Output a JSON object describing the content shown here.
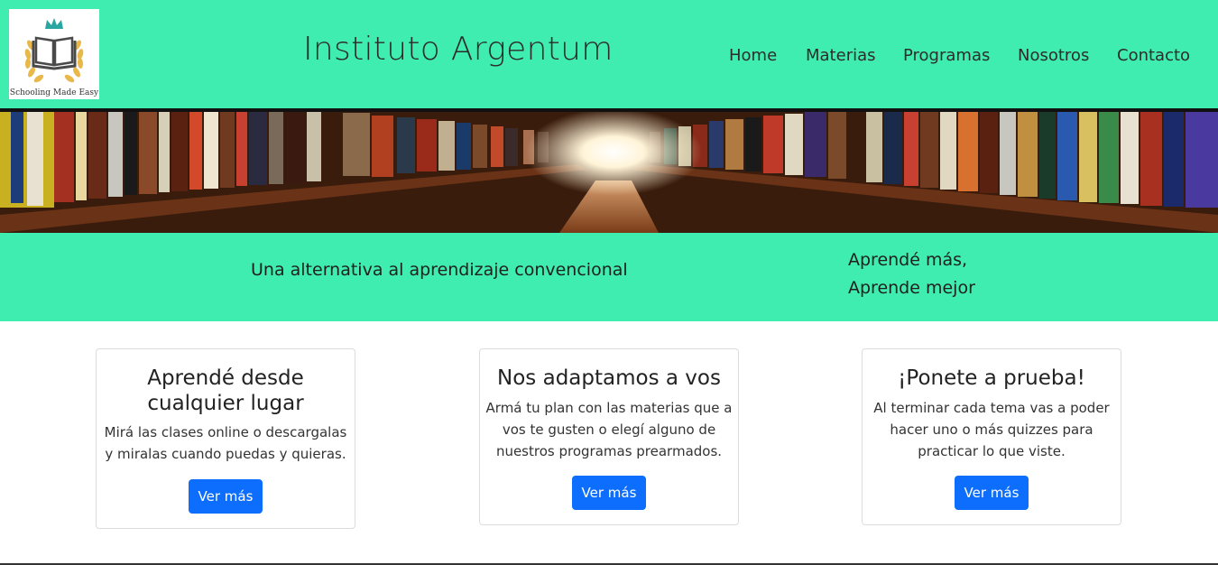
{
  "header": {
    "logo_text": "Schooling Made Easy",
    "title": "Instituto Argentum",
    "nav": [
      {
        "label": "Home"
      },
      {
        "label": "Materias"
      },
      {
        "label": "Programas"
      },
      {
        "label": "Nosotros"
      },
      {
        "label": "Contacto"
      }
    ]
  },
  "band": {
    "tagline_left": "Una alternativa al aprendizaje convencional",
    "tagline_right_line1": "Aprendé más,",
    "tagline_right_line2": "Aprende mejor"
  },
  "cards": [
    {
      "title_line1": "Aprendé desde",
      "title_line2": "cualquier lugar",
      "text_line1": "Mirá las clases online o descargalas",
      "text_line2": "y miralas cuando puedas y quieras.",
      "button": "Ver más"
    },
    {
      "title_line1": "Nos adaptamos a vos",
      "text_line1": "Armá tu plan con las materias que a",
      "text_line2": "vos te gusten o elegí alguno de",
      "text_line3": "nuestros programas prearmados.",
      "button": "Ver más"
    },
    {
      "title_line1": "¡Ponete a prueba!",
      "text_line1": "Al terminar cada tema vas a poder",
      "text_line2": "hacer uno o más quizzes para",
      "text_line3": "practicar lo que viste.",
      "button": "Ver más"
    }
  ],
  "colors": {
    "accent": "#3fedb0",
    "button": "#0d6efd"
  }
}
